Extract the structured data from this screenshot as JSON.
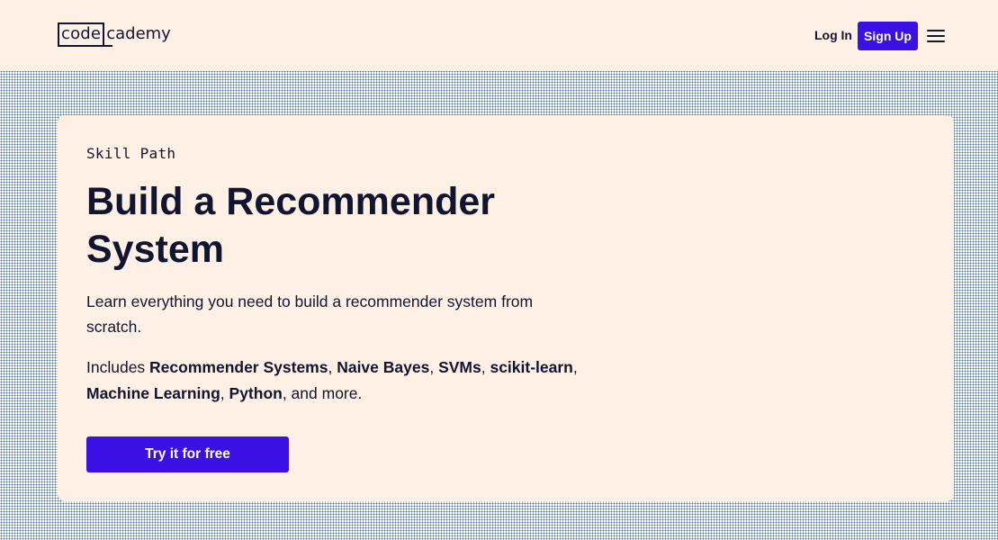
{
  "header": {
    "logo_boxed": "code",
    "logo_rest": "cademy",
    "login_label": "Log In",
    "signup_label": "Sign Up",
    "menu_icon": "hamburger-menu-icon"
  },
  "hero": {
    "eyebrow": "Skill Path",
    "title": "Build a Recommender System",
    "description": "Learn everything you need to build a recommender system from scratch.",
    "includes_prefix": "Includes ",
    "topics": [
      "Recommender Systems",
      "Naive Bayes",
      "SVMs",
      "scikit-learn",
      "Machine Learning",
      "Python"
    ],
    "includes_suffix": ", and more.",
    "cta_label": "Try it for free"
  },
  "colors": {
    "brand_primary": "#3a10e5",
    "text": "#10162f",
    "background": "#fff0e5",
    "pattern_dot": "#4b77a3"
  }
}
